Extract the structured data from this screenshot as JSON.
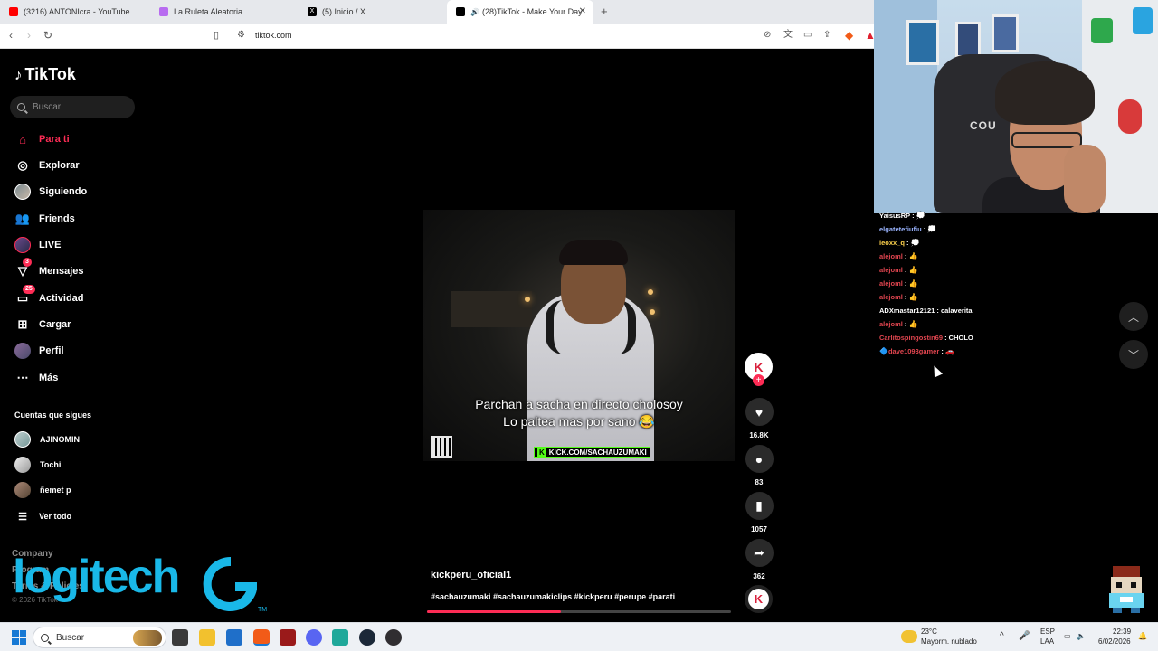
{
  "browser": {
    "tabs": [
      {
        "title": "(3216) ANTONIcra - YouTube",
        "favicon_color": "#ff0000"
      },
      {
        "title": "La Ruleta Aleatoria",
        "favicon_color": "#b86cf0"
      },
      {
        "title": "(5) Inicio / X",
        "favicon_color": "#000000"
      },
      {
        "title": "(28)TikTok - Make Your Day",
        "favicon_color": "#000000",
        "active": true
      }
    ],
    "url": "tiktok.com"
  },
  "tiktok": {
    "logo_text": "TikTok",
    "search_placeholder": "Buscar",
    "nav": [
      {
        "label": "Para ti",
        "icon": "home-icon",
        "active": true
      },
      {
        "label": "Explorar",
        "icon": "compass-icon"
      },
      {
        "label": "Siguiendo",
        "icon": "avatar-icon"
      },
      {
        "label": "Friends",
        "icon": "friends-icon"
      },
      {
        "label": "LIVE",
        "icon": "live-icon"
      },
      {
        "label": "Mensajes",
        "icon": "send-icon",
        "badge": "3"
      },
      {
        "label": "Actividad",
        "icon": "activity-icon",
        "badge": "25"
      },
      {
        "label": "Cargar",
        "icon": "upload-icon"
      },
      {
        "label": "Perfil",
        "icon": "profile-icon"
      },
      {
        "label": "Más",
        "icon": "more-icon"
      }
    ],
    "following_title": "Cuentas que sigues",
    "following": [
      {
        "name": "AJINOMIN"
      },
      {
        "name": "Tochi"
      },
      {
        "name": "ñemet p"
      }
    ],
    "see_all": "Ver todo",
    "footer": {
      "company": "Company",
      "program": "Program",
      "terms": "Terms & Policies",
      "copyright": "© 2026 TikTok"
    },
    "video": {
      "caption_line1": "Parchan a sacha en directo cholosoy",
      "caption_line2": "Lo paltea mas por sano 😂",
      "banner": "KICK.COM/SACHAUZUMAKI",
      "author": "kickperu_oficial1",
      "hashtags": "#sachauzumaki #sachauzumakiclips #kickperu #perupe #parati",
      "progress": 0.44
    },
    "actions": {
      "likes": "16.8K",
      "comments": "83",
      "saves": "1057",
      "shares": "362"
    }
  },
  "overlay": {
    "logitech_text": "logitech",
    "logitech_tm": "TM"
  },
  "chat": [
    {
      "user": "YaisusRP",
      "color": "#ffffff",
      "msg": " : "
    },
    {
      "user": "elgatetefiufiu",
      "color": "#9ab4ff",
      "msg": " : "
    },
    {
      "user": "leoxx_q",
      "color": "#ffd34d",
      "msg": " : "
    },
    {
      "user": "alejoml",
      "color": "#e0454f",
      "msg": " : "
    },
    {
      "user": "alejoml",
      "color": "#e0454f",
      "msg": " : "
    },
    {
      "user": "alejoml",
      "color": "#e0454f",
      "msg": " : "
    },
    {
      "user": "alejoml",
      "color": "#e0454f",
      "msg": " : "
    },
    {
      "user": "ADXmastar12121",
      "color": "#ffffff",
      "msg": " : calaverita"
    },
    {
      "user": "alejoml",
      "color": "#e0454f",
      "msg": " : "
    },
    {
      "user": "Carlitospingostin69",
      "color": "#e0454f",
      "msg": " : CHOLO"
    },
    {
      "user": "dave1093gamer",
      "color": "#e0454f",
      "msg": " : "
    }
  ],
  "taskbar": {
    "search_placeholder": "Buscar",
    "weather_temp": "23°C",
    "weather_desc": "Mayorm. nublado",
    "lang_line1": "ESP",
    "lang_line2": "LAA",
    "time": "22:39",
    "date": "6/02/2026"
  }
}
